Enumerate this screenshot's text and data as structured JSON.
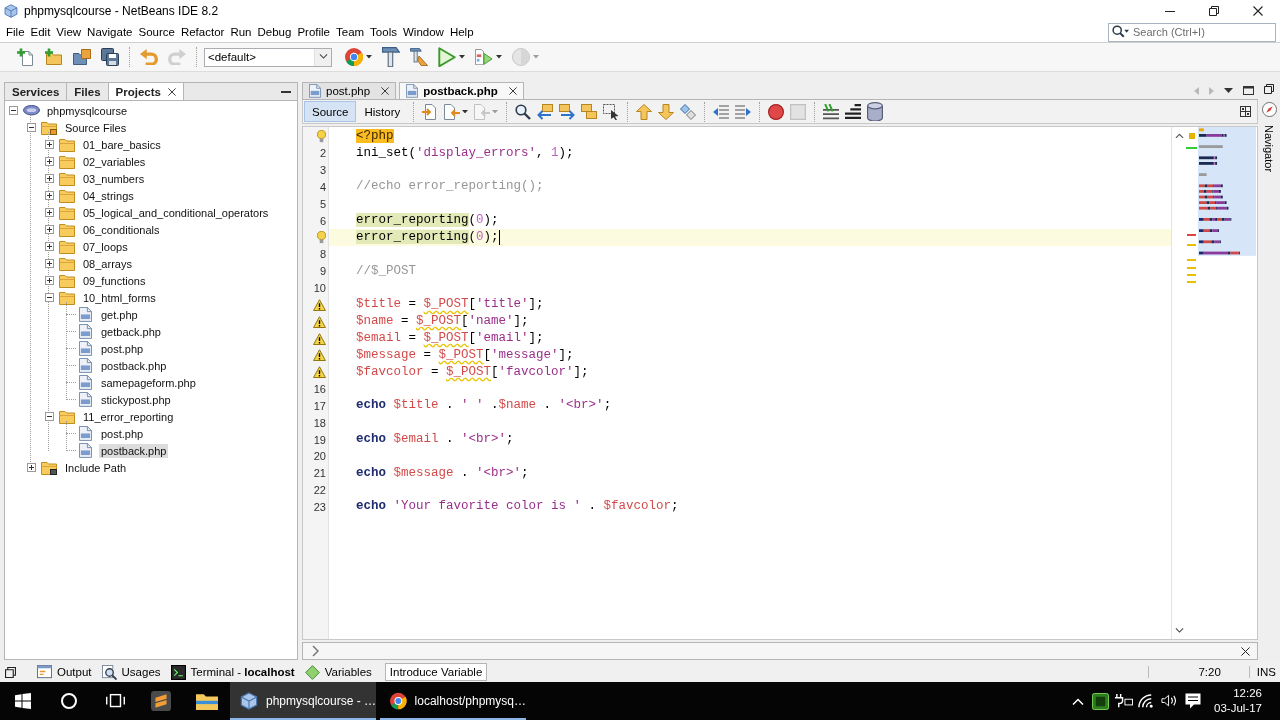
{
  "window": {
    "title": "phpmysqlcourse - NetBeans IDE 8.2"
  },
  "menu": [
    "File",
    "Edit",
    "View",
    "Navigate",
    "Source",
    "Refactor",
    "Run",
    "Debug",
    "Profile",
    "Team",
    "Tools",
    "Window",
    "Help"
  ],
  "search": {
    "placeholder": "Search (Ctrl+I)"
  },
  "toolbar": [
    {
      "kind": "new-file",
      "disabled": false,
      "menu": false
    },
    {
      "kind": "new-project",
      "disabled": false,
      "menu": false
    },
    {
      "kind": "open-project",
      "disabled": false,
      "menu": false
    },
    {
      "kind": "save-all",
      "disabled": false,
      "menu": false
    },
    {
      "kind": "separator"
    },
    {
      "kind": "undo",
      "disabled": false,
      "menu": false
    },
    {
      "kind": "redo",
      "disabled": true,
      "menu": false
    },
    {
      "kind": "separator"
    },
    {
      "kind": "select",
      "value": "<default>"
    },
    {
      "kind": "browser",
      "disabled": false,
      "menu": true
    },
    {
      "kind": "build",
      "disabled": false,
      "menu": false
    },
    {
      "kind": "clean-build",
      "disabled": false,
      "menu": false
    },
    {
      "kind": "run",
      "disabled": false,
      "menu": true
    },
    {
      "kind": "debug",
      "disabled": false,
      "menu": true
    },
    {
      "kind": "profile",
      "disabled": true,
      "menu": true
    }
  ],
  "side_panel": {
    "tabs": [
      {
        "label": "Services",
        "selected": false,
        "closable": false
      },
      {
        "label": "Files",
        "selected": false,
        "closable": false
      },
      {
        "label": "Projects",
        "selected": true,
        "closable": true
      }
    ],
    "tree": [
      {
        "kind": "project",
        "label": "phpmysqlcourse",
        "expanded": true,
        "selected": false,
        "children": [
          {
            "kind": "source",
            "label": "Source Files",
            "expanded": true,
            "selected": false,
            "children": [
              {
                "kind": "folder",
                "label": "01_bare_basics",
                "expanded": false,
                "selected": false
              },
              {
                "kind": "folder",
                "label": "02_variables",
                "expanded": false,
                "selected": false
              },
              {
                "kind": "folder",
                "label": "03_numbers",
                "expanded": false,
                "selected": false
              },
              {
                "kind": "folder",
                "label": "04_strings",
                "expanded": false,
                "selected": false
              },
              {
                "kind": "folder",
                "label": "05_logical_and_conditional_operators",
                "expanded": false,
                "selected": false
              },
              {
                "kind": "folder",
                "label": "06_conditionals",
                "expanded": false,
                "selected": false
              },
              {
                "kind": "folder",
                "label": "07_loops",
                "expanded": false,
                "selected": false
              },
              {
                "kind": "folder",
                "label": "08_arrays",
                "expanded": false,
                "selected": false
              },
              {
                "kind": "folder",
                "label": "09_functions",
                "expanded": false,
                "selected": false
              },
              {
                "kind": "folder",
                "label": "10_html_forms",
                "expanded": true,
                "selected": false,
                "children": [
                  {
                    "kind": "file",
                    "label": "get.php",
                    "selected": false
                  },
                  {
                    "kind": "file",
                    "label": "getback.php",
                    "selected": false
                  },
                  {
                    "kind": "file",
                    "label": "post.php",
                    "selected": false
                  },
                  {
                    "kind": "file",
                    "label": "postback.php",
                    "selected": false
                  },
                  {
                    "kind": "file",
                    "label": "samepageform.php",
                    "selected": false
                  },
                  {
                    "kind": "file",
                    "label": "stickypost.php",
                    "selected": false
                  }
                ]
              },
              {
                "kind": "folder",
                "label": "11_error_reporting",
                "expanded": true,
                "selected": false,
                "children": [
                  {
                    "kind": "file",
                    "label": "post.php",
                    "selected": false
                  },
                  {
                    "kind": "file",
                    "label": "postback.php",
                    "selected": true
                  }
                ]
              }
            ]
          },
          {
            "kind": "include",
            "label": "Include Path",
            "expanded": false,
            "selected": false
          }
        ]
      }
    ]
  },
  "editor": {
    "tabs": [
      {
        "label": "post.php",
        "selected": false
      },
      {
        "label": "postback.php",
        "selected": true
      }
    ],
    "views": [
      {
        "label": "Source",
        "selected": true
      },
      {
        "label": "History",
        "selected": false
      }
    ],
    "toolbar": [
      {
        "kind": "last-edit",
        "disabled": false,
        "menu": false
      },
      {
        "kind": "back",
        "disabled": false,
        "menu": true
      },
      {
        "kind": "forward",
        "disabled": true,
        "menu": true
      },
      {
        "kind": "separator"
      },
      {
        "kind": "find",
        "disabled": false,
        "menu": false
      },
      {
        "kind": "find-previous",
        "disabled": false,
        "menu": false
      },
      {
        "kind": "find-next",
        "disabled": false,
        "menu": false
      },
      {
        "kind": "highlight",
        "disabled": false,
        "menu": false
      },
      {
        "kind": "rect-select",
        "disabled": false,
        "menu": false
      },
      {
        "kind": "separator"
      },
      {
        "kind": "previous-bookmark",
        "disabled": false,
        "menu": false
      },
      {
        "kind": "next-bookmark",
        "disabled": false,
        "menu": false
      },
      {
        "kind": "toggle-bookmark",
        "disabled": false,
        "menu": false
      },
      {
        "kind": "separator"
      },
      {
        "kind": "shift-left",
        "disabled": false,
        "menu": false
      },
      {
        "kind": "shift-right",
        "disabled": false,
        "menu": false
      },
      {
        "kind": "separator"
      },
      {
        "kind": "start-macro",
        "disabled": false,
        "menu": false
      },
      {
        "kind": "stop-macro",
        "disabled": true,
        "menu": false
      },
      {
        "kind": "separator"
      },
      {
        "kind": "comment",
        "disabled": false,
        "menu": false
      },
      {
        "kind": "uncomment",
        "disabled": false,
        "menu": false
      },
      {
        "kind": "database",
        "disabled": false,
        "menu": false
      }
    ],
    "lines": [
      {
        "kind": "hint",
        "current": false,
        "tokens": [
          {
            "kind": "tag",
            "text": "<?php"
          }
        ]
      },
      {
        "kind": "numbered",
        "number": "2",
        "current": false,
        "tokens": [
          {
            "kind": "plain",
            "text": "ini_set("
          },
          {
            "kind": "string",
            "text": "'display_errors'"
          },
          {
            "kind": "plain",
            "text": ", "
          },
          {
            "kind": "number",
            "text": "1"
          },
          {
            "kind": "plain",
            "text": ");"
          }
        ]
      },
      {
        "kind": "numbered",
        "number": "3",
        "current": false
      },
      {
        "kind": "numbered",
        "number": "4",
        "current": false,
        "tokens": [
          {
            "kind": "comment",
            "text": "//echo error_reporting();"
          }
        ]
      },
      {
        "kind": "numbered",
        "number": "5",
        "current": false
      },
      {
        "kind": "numbered",
        "number": "6",
        "current": false,
        "tokens": [
          {
            "kind": "occurrence",
            "text": "error_reporting"
          },
          {
            "kind": "plain",
            "text": "("
          },
          {
            "kind": "number",
            "text": "0"
          },
          {
            "kind": "plain",
            "text": ");"
          }
        ]
      },
      {
        "kind": "hint",
        "current": true,
        "tokens": [
          {
            "kind": "occurrence",
            "text": "error_reporting"
          },
          {
            "kind": "plain",
            "text": "("
          },
          {
            "kind": "number",
            "text": "0"
          },
          {
            "kind": "plain",
            "text": ");"
          }
        ]
      },
      {
        "kind": "numbered",
        "number": "8",
        "current": false
      },
      {
        "kind": "numbered",
        "number": "9",
        "current": false,
        "tokens": [
          {
            "kind": "comment",
            "text": "//$_POST"
          }
        ]
      },
      {
        "kind": "numbered",
        "number": "10",
        "current": false
      },
      {
        "kind": "warning",
        "current": false,
        "tokens": [
          {
            "kind": "variable",
            "text": "$title"
          },
          {
            "kind": "plain",
            "text": " = "
          },
          {
            "kind": "superglobal",
            "text": "$_POST"
          },
          {
            "kind": "plain",
            "text": "["
          },
          {
            "kind": "string",
            "text": "'title'"
          },
          {
            "kind": "plain",
            "text": "];"
          }
        ]
      },
      {
        "kind": "warning",
        "current": false,
        "tokens": [
          {
            "kind": "variable",
            "text": "$name"
          },
          {
            "kind": "plain",
            "text": " = "
          },
          {
            "kind": "superglobal",
            "text": "$_POST"
          },
          {
            "kind": "plain",
            "text": "["
          },
          {
            "kind": "string",
            "text": "'name'"
          },
          {
            "kind": "plain",
            "text": "];"
          }
        ]
      },
      {
        "kind": "warning",
        "current": false,
        "tokens": [
          {
            "kind": "variable",
            "text": "$email"
          },
          {
            "kind": "plain",
            "text": " = "
          },
          {
            "kind": "superglobal",
            "text": "$_POST"
          },
          {
            "kind": "plain",
            "text": "["
          },
          {
            "kind": "string",
            "text": "'email'"
          },
          {
            "kind": "plain",
            "text": "];"
          }
        ]
      },
      {
        "kind": "warning",
        "current": false,
        "tokens": [
          {
            "kind": "variable",
            "text": "$message"
          },
          {
            "kind": "plain",
            "text": " = "
          },
          {
            "kind": "superglobal",
            "text": "$_POST"
          },
          {
            "kind": "plain",
            "text": "["
          },
          {
            "kind": "string",
            "text": "'message'"
          },
          {
            "kind": "plain",
            "text": "];"
          }
        ]
      },
      {
        "kind": "warning",
        "current": false,
        "tokens": [
          {
            "kind": "variable",
            "text": "$favcolor"
          },
          {
            "kind": "plain",
            "text": " = "
          },
          {
            "kind": "superglobal",
            "text": "$_POST"
          },
          {
            "kind": "plain",
            "text": "["
          },
          {
            "kind": "string",
            "text": "'favcolor'"
          },
          {
            "kind": "plain",
            "text": "];"
          }
        ]
      },
      {
        "kind": "numbered",
        "number": "16",
        "current": false
      },
      {
        "kind": "numbered",
        "number": "17",
        "current": false,
        "tokens": [
          {
            "kind": "keyword",
            "text": "echo "
          },
          {
            "kind": "variable",
            "text": "$title"
          },
          {
            "kind": "plain",
            "text": " . "
          },
          {
            "kind": "string",
            "text": "' '"
          },
          {
            "kind": "plain",
            "text": " ."
          },
          {
            "kind": "variable",
            "text": "$name"
          },
          {
            "kind": "plain",
            "text": " . "
          },
          {
            "kind": "string",
            "text": "'<br>'"
          },
          {
            "kind": "plain",
            "text": ";"
          }
        ]
      },
      {
        "kind": "numbered",
        "number": "18",
        "current": false
      },
      {
        "kind": "numbered",
        "number": "19",
        "current": false,
        "tokens": [
          {
            "kind": "keyword",
            "text": "echo "
          },
          {
            "kind": "variable",
            "text": "$email"
          },
          {
            "kind": "plain",
            "text": " . "
          },
          {
            "kind": "string",
            "text": "'<br>'"
          },
          {
            "kind": "plain",
            "text": ";"
          }
        ]
      },
      {
        "kind": "numbered",
        "number": "20",
        "current": false
      },
      {
        "kind": "numbered",
        "number": "21",
        "current": false,
        "tokens": [
          {
            "kind": "keyword",
            "text": "echo "
          },
          {
            "kind": "variable",
            "text": "$message"
          },
          {
            "kind": "plain",
            "text": " . "
          },
          {
            "kind": "string",
            "text": "'<br>'"
          },
          {
            "kind": "plain",
            "text": ";"
          }
        ]
      },
      {
        "kind": "numbered",
        "number": "22",
        "current": false
      },
      {
        "kind": "numbered",
        "number": "23",
        "current": false,
        "tokens": [
          {
            "kind": "keyword",
            "text": "echo "
          },
          {
            "kind": "string",
            "text": "'Your favorite color is '"
          },
          {
            "kind": "plain",
            "text": " . "
          },
          {
            "kind": "variable",
            "text": "$favcolor"
          },
          {
            "kind": "plain",
            "text": ";"
          }
        ]
      }
    ]
  },
  "navigator": {
    "label": "Navigator"
  },
  "bottom_tabs": [
    {
      "kind": "output",
      "label": "Output"
    },
    {
      "kind": "usages",
      "label": "Usages"
    },
    {
      "kind": "terminal",
      "label": "Terminal - **localhost**"
    },
    {
      "kind": "variables",
      "label": "Variables"
    }
  ],
  "status": {
    "hint": "Introduce Variable",
    "position": "7:20",
    "mode": "INS"
  },
  "taskbar": {
    "apps": [
      {
        "kind": "text-editor",
        "selected": false,
        "running": false
      },
      {
        "kind": "files",
        "selected": false,
        "running": false
      },
      {
        "kind": "ide",
        "label": "phpmysqlcourse - …",
        "selected": true,
        "running": true
      },
      {
        "kind": "browser",
        "label": "localhost/phpmysq…",
        "selected": false,
        "running": true
      }
    ],
    "time": "12:26",
    "date": "03-Jul-17"
  }
}
